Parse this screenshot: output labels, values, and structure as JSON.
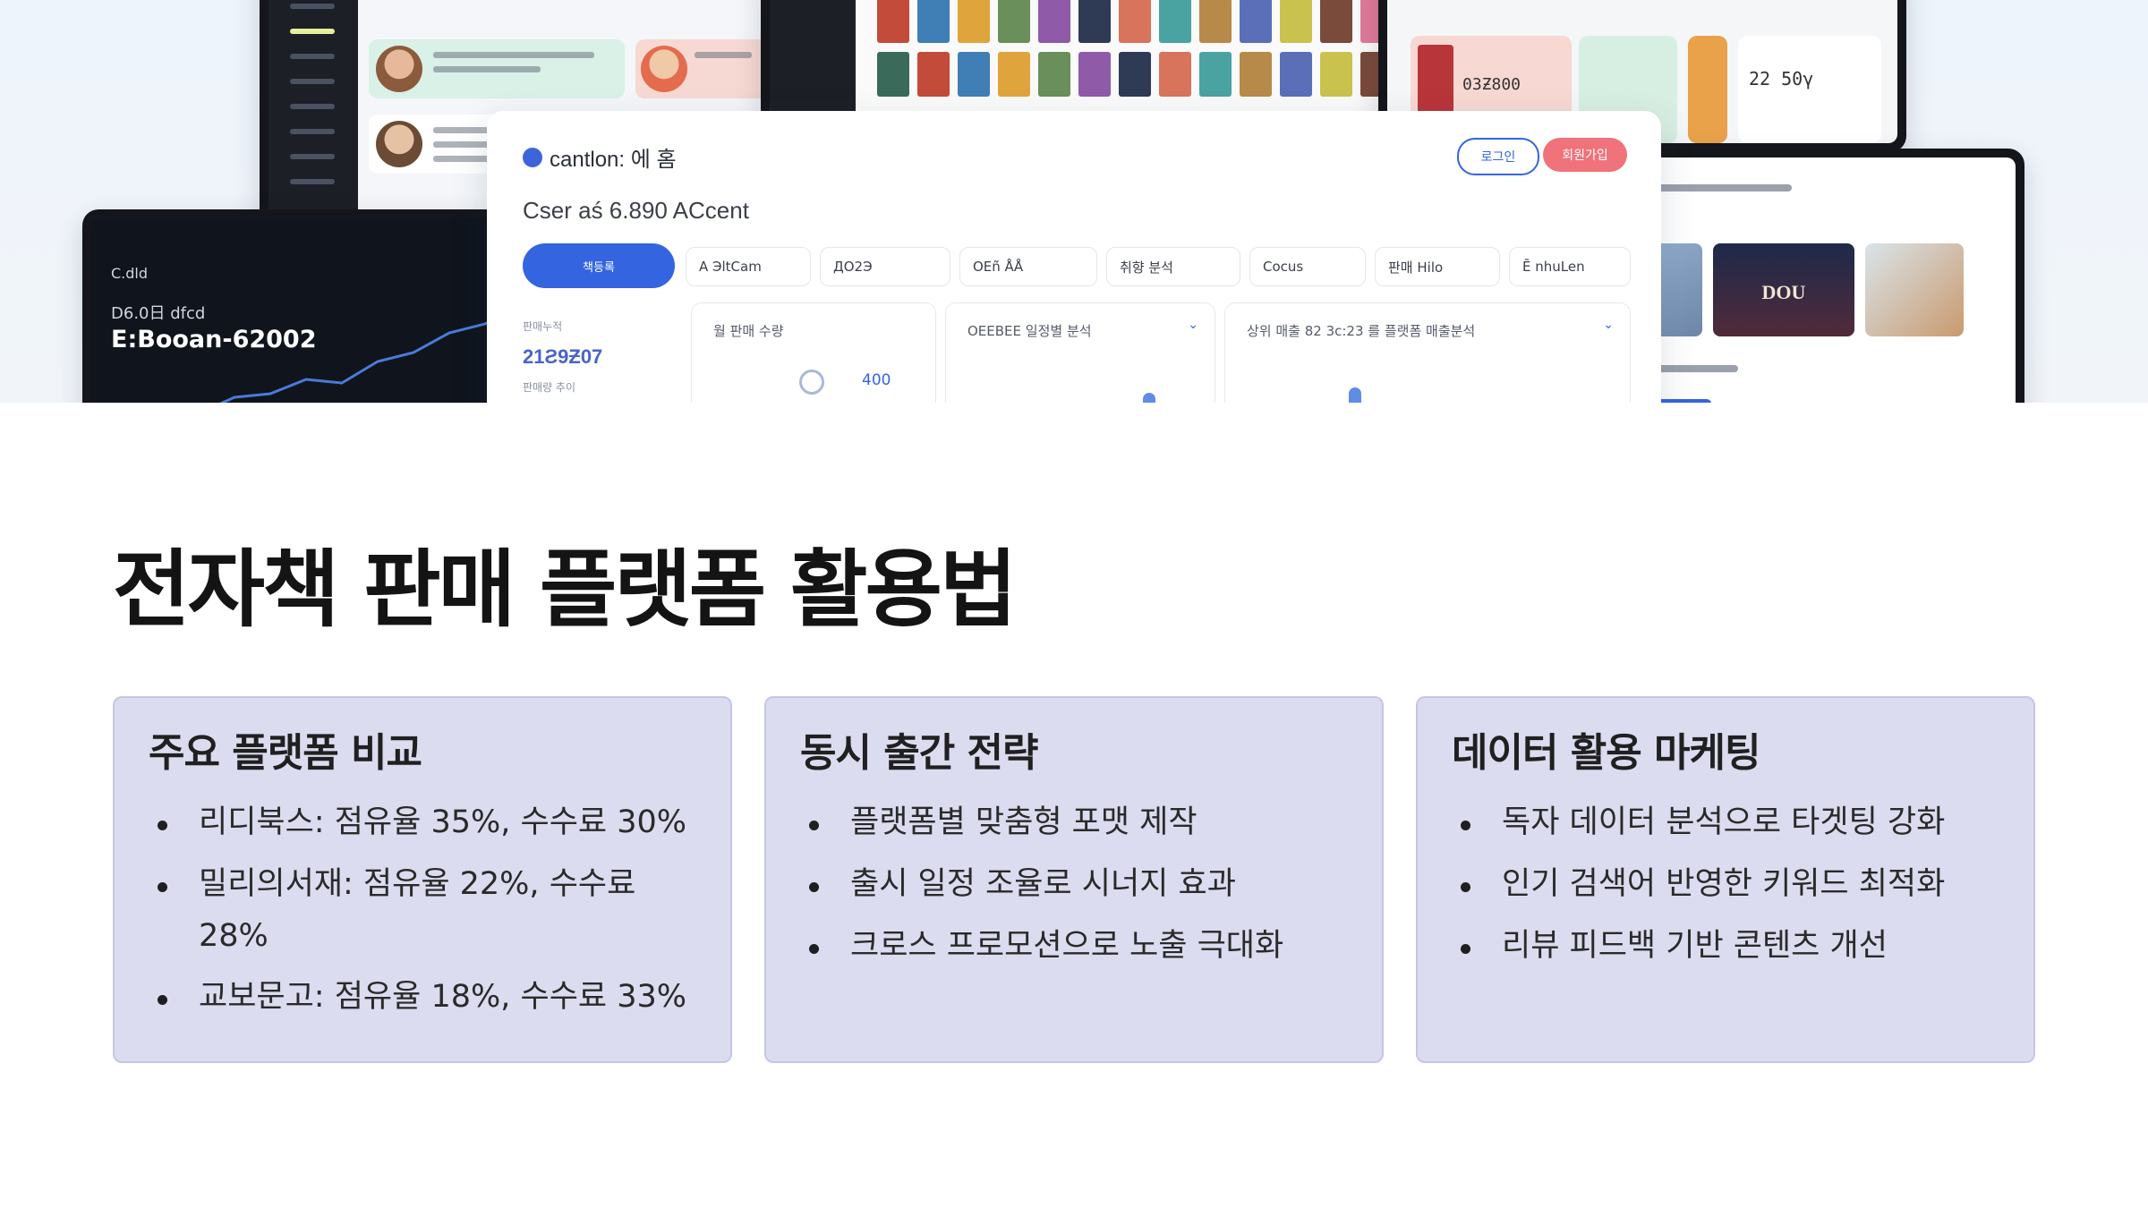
{
  "hero": {
    "panel_brand": "cantlon: 에 홈",
    "panel_btn_login": "로그인",
    "panel_btn_signup": "회원가입",
    "panel_title": "Cser aś 6.890 ACcent",
    "panel_primary": "책등록",
    "panel_chips": [
      "A ЭltCam",
      "ДO2Э",
      "OEñ ÅÅ",
      "취향 분석",
      "Cocus",
      "판매 Hilo",
      "Ē nhuLen"
    ],
    "panel_stat_label": "판매누적",
    "panel_stat_value": "21Ƨ9Ƶ07",
    "panel_stat_sub": "판매량 추이",
    "widget_1_title": "월 판매 수량",
    "widget_1_value": "400",
    "widget_2_title": "OEEBEE 일정별 분석",
    "widget_3_title": "상위 매출 82 3c:23 를 플랫폼 매출분석",
    "bl_head": "C.dld",
    "bl_sub": "D6.0日 dfcd",
    "bl_title": "E:Booan-62002",
    "tr_value_1": "03Ƶ800",
    "tr_value_2": "22 50γ",
    "thumb_label": "DOU"
  },
  "title": "전자책 판매 플랫폼 활용법",
  "cards": [
    {
      "heading": "주요 플랫폼 비교",
      "items": [
        "리디북스: 점유율 35%, 수수료 30%",
        "밀리의서재: 점유율 22%, 수수료 28%",
        "교보문고: 점유율 18%, 수수료 33%"
      ]
    },
    {
      "heading": "동시 출간 전략",
      "items": [
        "플랫폼별 맞춤형 포맷 제작",
        "출시 일정 조율로 시너지 효과",
        "크로스 프로모션으로 노출 극대화"
      ]
    },
    {
      "heading": "데이터 활용 마케팅",
      "items": [
        "독자 데이터 분석으로 타겟팅 강화",
        "인기 검색어 반영한 키워드 최적화",
        "리뷰 피드백 기반 콘텐츠 개선"
      ]
    }
  ]
}
